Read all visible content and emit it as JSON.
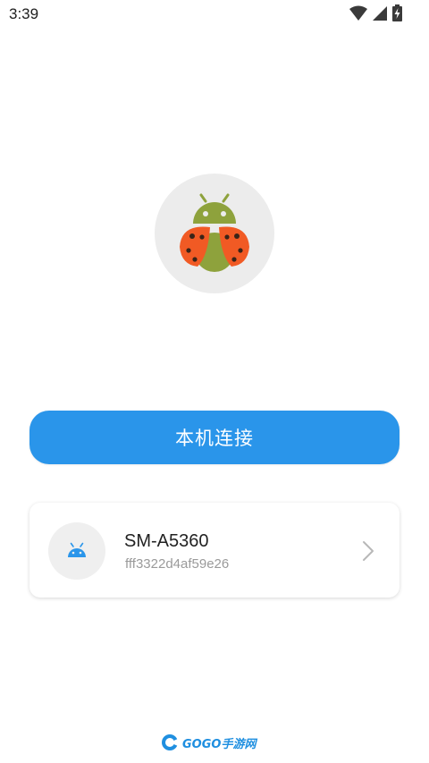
{
  "status_bar": {
    "time": "3:39",
    "icons": [
      "wifi-icon",
      "cell-signal-icon",
      "battery-charging-icon"
    ]
  },
  "logo": {
    "icon": "ladybug-android-logo",
    "colors": {
      "android_green": "#8ea23c",
      "wing_orange": "#f15a24",
      "spots": "#3a2418",
      "circle_bg": "#ececec"
    }
  },
  "connect_button": {
    "label": "本机连接",
    "color": "#2a95ea"
  },
  "device": {
    "name": "SM-A5360",
    "serial": "fff3322d4af59e26",
    "icon": "android-icon",
    "icon_color": "#2a95ea"
  },
  "watermark": {
    "text": "GOGO手游网"
  }
}
